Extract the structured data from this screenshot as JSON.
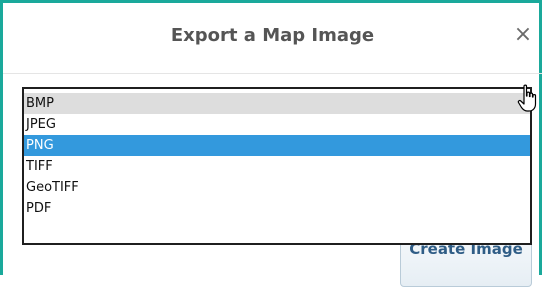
{
  "dialog": {
    "title": "Export a Map Image",
    "close_glyph": "×",
    "format_options": [
      "BMP",
      "JPEG",
      "PNG",
      "TIFF",
      "GeoTIFF",
      "PDF"
    ],
    "hovered_option": "BMP",
    "selected_option": "PNG",
    "create_button_label": "Create Image"
  },
  "colors": {
    "accent_border": "#1aa99b",
    "selection": "#3399dd",
    "hover": "#dddddd"
  },
  "icons": {
    "close": "close-icon",
    "cursor": "hand-pointer-icon"
  }
}
